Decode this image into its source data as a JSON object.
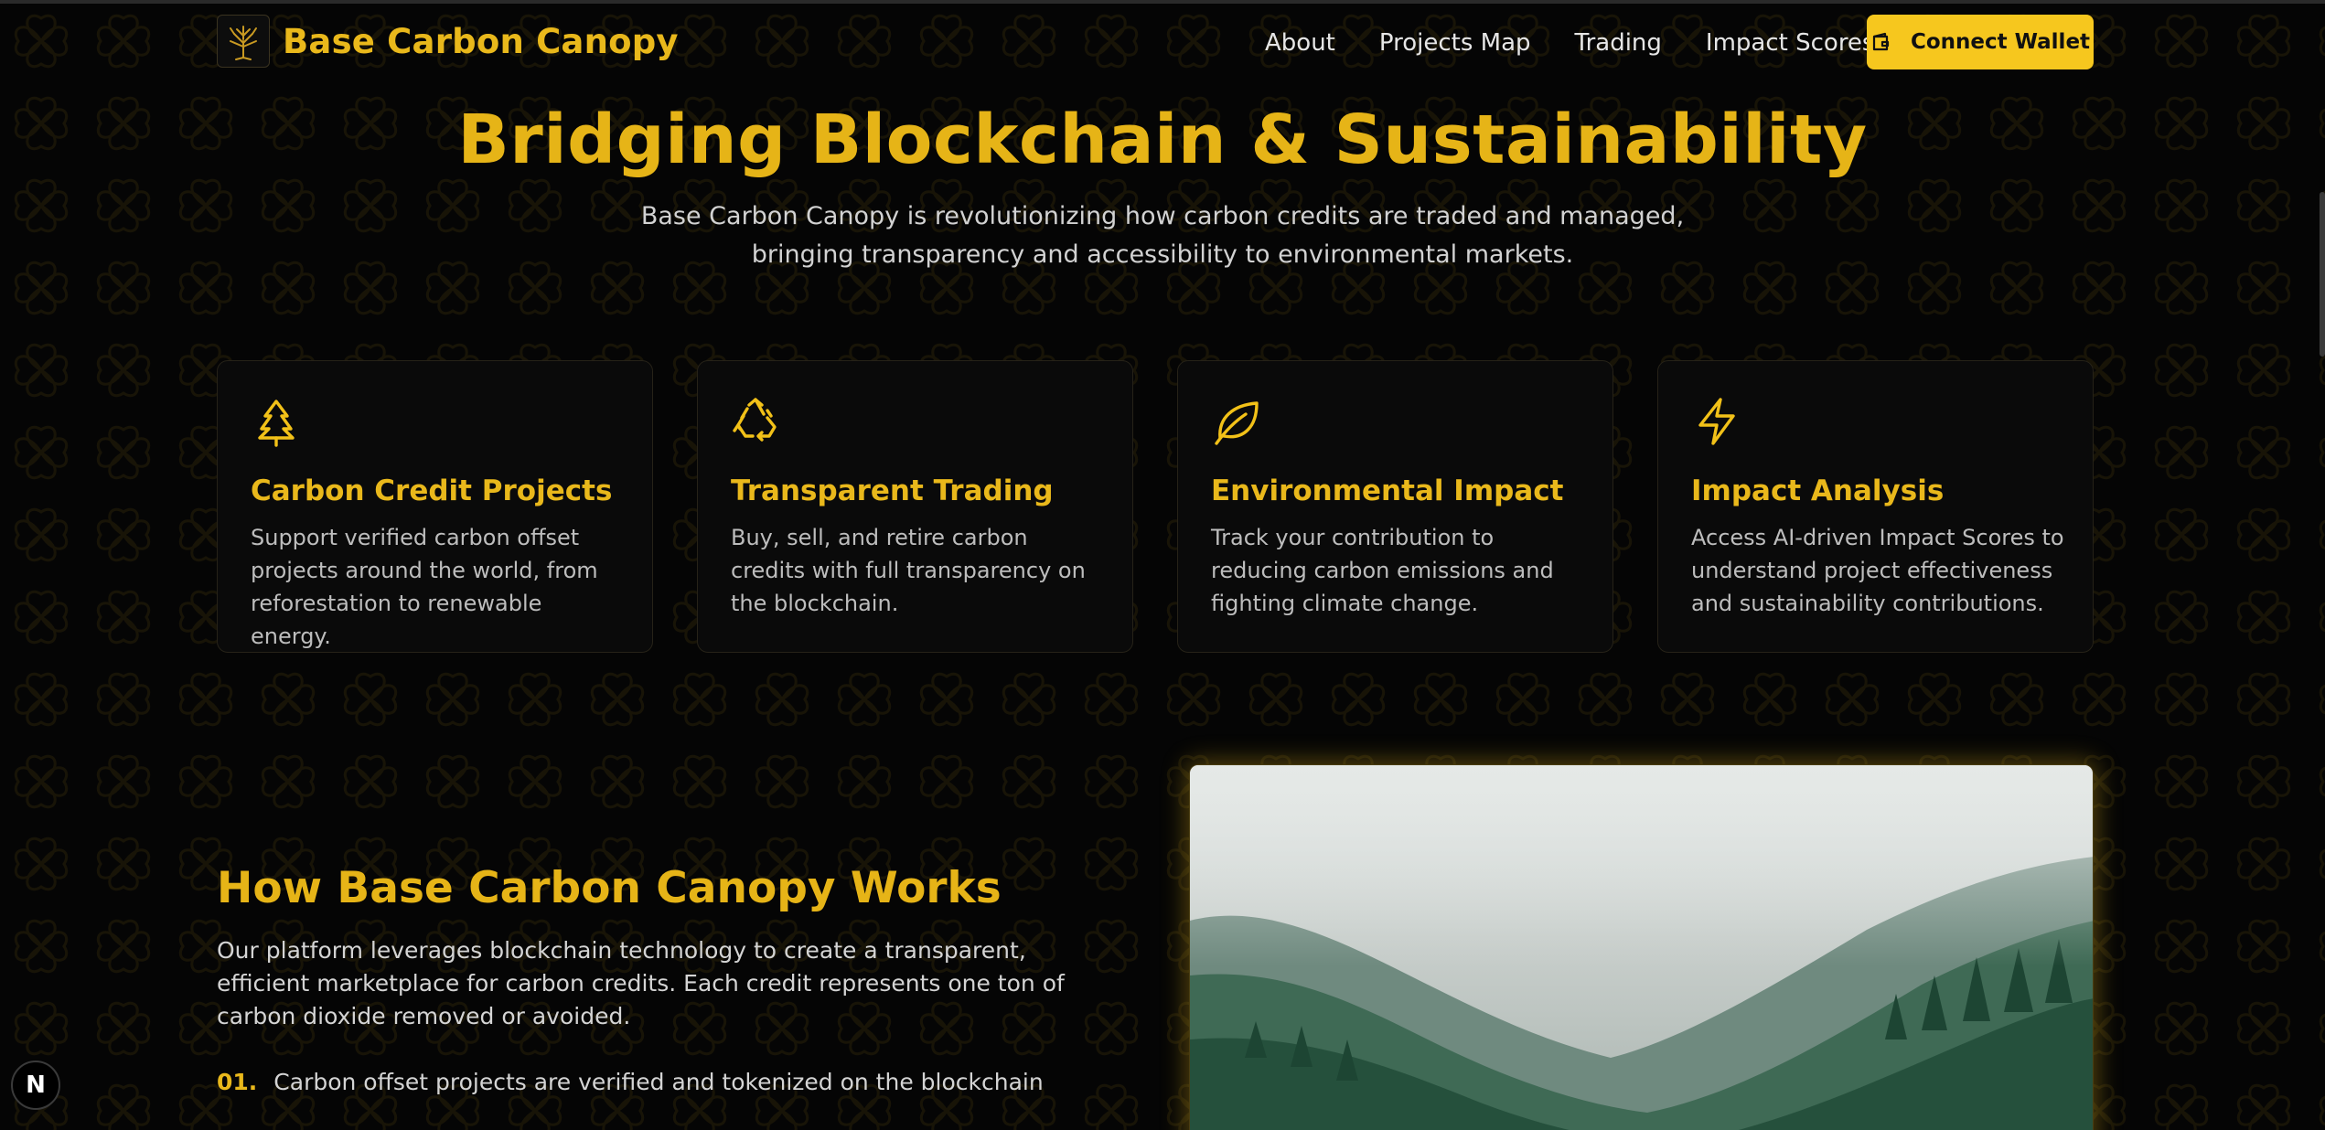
{
  "header": {
    "brand": "Base Carbon Canopy",
    "nav": [
      "About",
      "Projects Map",
      "Trading",
      "Impact Scores"
    ],
    "wallet_button": "Connect Wallet"
  },
  "hero": {
    "title": "Bridging Blockchain & Sustainability",
    "subtitle_line1": "Base Carbon Canopy is revolutionizing how carbon credits are traded and managed,",
    "subtitle_line2": "bringing transparency and accessibility to environmental markets."
  },
  "features": [
    {
      "icon": "tree-icon",
      "title": "Carbon Credit Projects",
      "text": "Support verified carbon offset projects around the world, from reforestation to renewable energy."
    },
    {
      "icon": "recycle-icon",
      "title": "Transparent Trading",
      "text": "Buy, sell, and retire carbon credits with full transparency on the blockchain."
    },
    {
      "icon": "leaf-icon",
      "title": "Environmental Impact",
      "text": "Track your contribution to reducing carbon emissions and fighting climate change."
    },
    {
      "icon": "lightning-icon",
      "title": "Impact Analysis",
      "text": "Access AI-driven Impact Scores to understand project effectiveness and sustainability contributions."
    }
  ],
  "how": {
    "title": "How Base Carbon Canopy Works",
    "text": "Our platform leverages blockchain technology to create a transparent, efficient marketplace for carbon credits. Each credit represents one ton of carbon dioxide removed or avoided.",
    "steps": [
      {
        "num": "01.",
        "text": "Carbon offset projects are verified and tokenized on the blockchain"
      }
    ]
  },
  "badge": "N",
  "colors": {
    "accent": "#e9b81b",
    "button": "#f6c71e",
    "background": "#050505"
  }
}
